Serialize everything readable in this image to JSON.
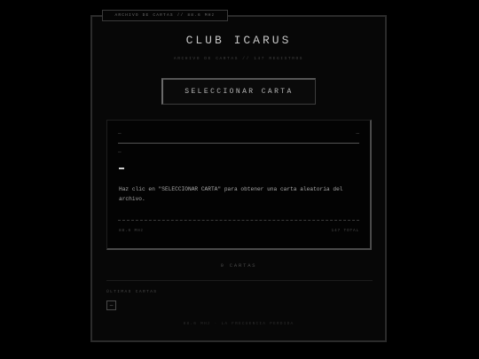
{
  "header": {
    "archive_tag": "ARCHIVO DE CARTAS // 88.6 MHz",
    "title": "CLUB ICARUS",
    "subtitle": "ARCHIVO DE CARTAS // 147 REGISTROS"
  },
  "actions": {
    "select_label": "SELECCIONAR CARTA"
  },
  "card": {
    "corner_left": "—",
    "corner_right": "—",
    "line_marker": "—",
    "message": "Haz clic en \"SELECCIONAR CARTA\" para obtener una carta aleatoria del archivo.",
    "footer_left": "88.6 MHz",
    "footer_right": "147 TOTAL"
  },
  "stats": {
    "count_label": "0 CARTAS"
  },
  "recent": {
    "label": "ÚLTIMAS CARTAS",
    "items": [
      "—"
    ]
  },
  "footer": {
    "text": "88.6 MHz · LA FRECUENCIA PERDIDA"
  }
}
